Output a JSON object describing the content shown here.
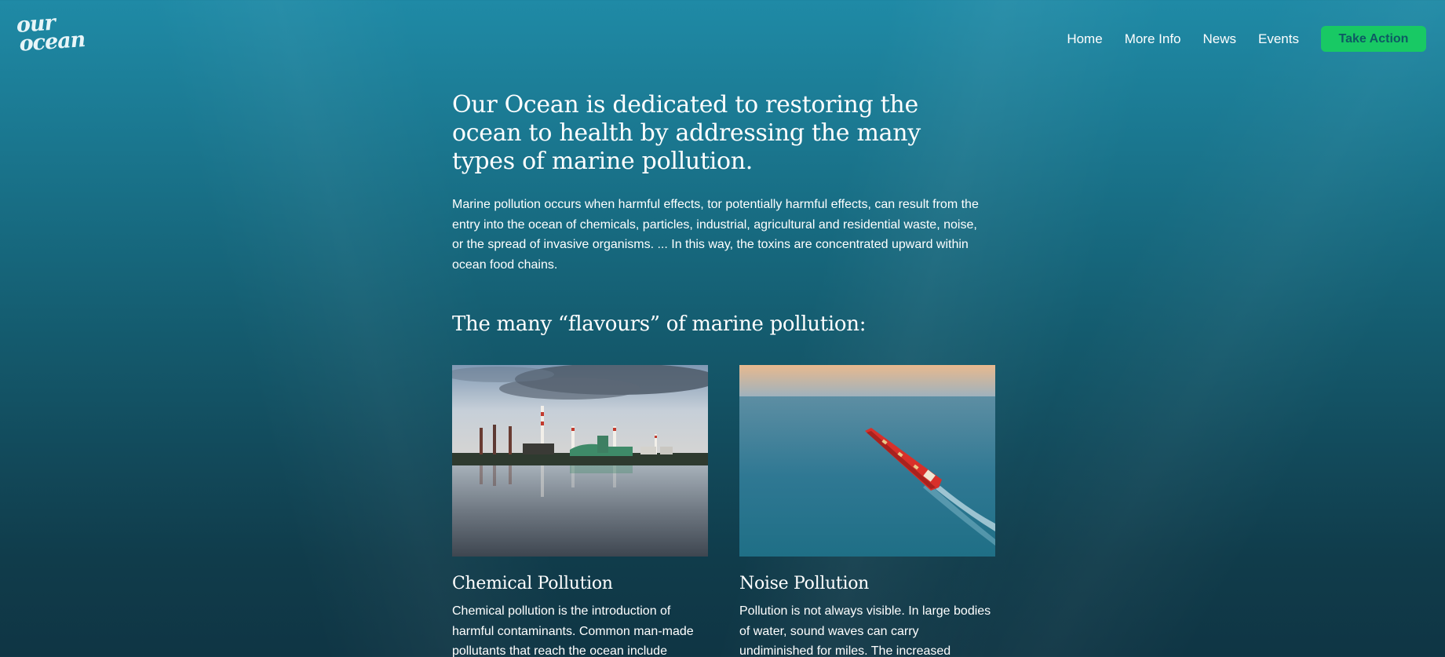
{
  "brand": {
    "logo_line1": "our",
    "logo_line2": "ocean"
  },
  "nav": {
    "items": [
      "Home",
      "More Info",
      "News",
      "Events"
    ],
    "cta_label": "Take Action"
  },
  "colors": {
    "accent": "#18c964",
    "accent_text": "#0e5a63",
    "background_top": "#1f8aa6",
    "background_bottom": "#0f3544"
  },
  "main": {
    "title": "Our Ocean is dedicated to restoring the ocean to health by addressing the many types of marine pollution.",
    "intro": "Marine pollution occurs when harmful effects, tor potentially harmful effects, can result from the entry into the ocean of chemicals, particles, industrial, agricultural and residential waste, noise, or the spread of invasive organisms. ... In this way, the toxins are concentrated upward within ocean food chains.",
    "section_title": "The many “flavours” of marine pollution:"
  },
  "cards": [
    {
      "image": "industrial-waterfront-photo",
      "title": "Chemical Pollution",
      "text": "Chemical pollution is the introduction of harmful contaminants. Common man-made pollutants that reach the ocean include"
    },
    {
      "image": "red-cargo-ship-photo",
      "title": "Noise Pollution",
      "text": "Pollution is not always visible. In large bodies of water, sound waves can carry undiminished for miles. The increased presence of loud or"
    }
  ]
}
